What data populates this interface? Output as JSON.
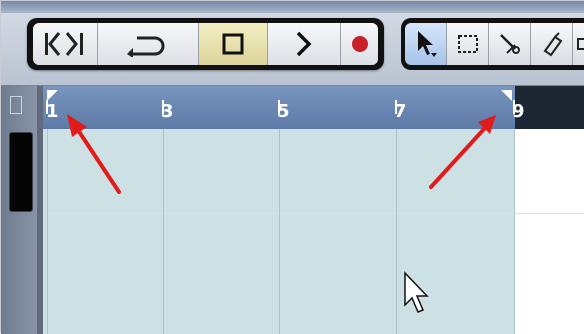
{
  "transport": {
    "buttons": [
      {
        "name": "goto-start-end",
        "icon": "skip-start-end-icon"
      },
      {
        "name": "cycle",
        "icon": "cycle-icon"
      },
      {
        "name": "stop",
        "icon": "stop-icon",
        "active": true
      },
      {
        "name": "play",
        "icon": "play-icon"
      },
      {
        "name": "record",
        "icon": "record-icon"
      }
    ]
  },
  "tools": [
    {
      "name": "pointer",
      "icon": "pointer-icon",
      "active": true
    },
    {
      "name": "range",
      "icon": "range-select-icon"
    },
    {
      "name": "split",
      "icon": "scissors-icon"
    },
    {
      "name": "glue",
      "icon": "glue-icon"
    },
    {
      "name": "erase",
      "icon": "erase-icon"
    }
  ],
  "ruler": {
    "bar_labels": [
      "1",
      "3",
      "5",
      "7",
      "9"
    ]
  },
  "colors": {
    "loop_region": "#6a86b1",
    "grid_loop": "#cde0e4",
    "arrow": "#e11b1b",
    "record": "#c8202a"
  }
}
